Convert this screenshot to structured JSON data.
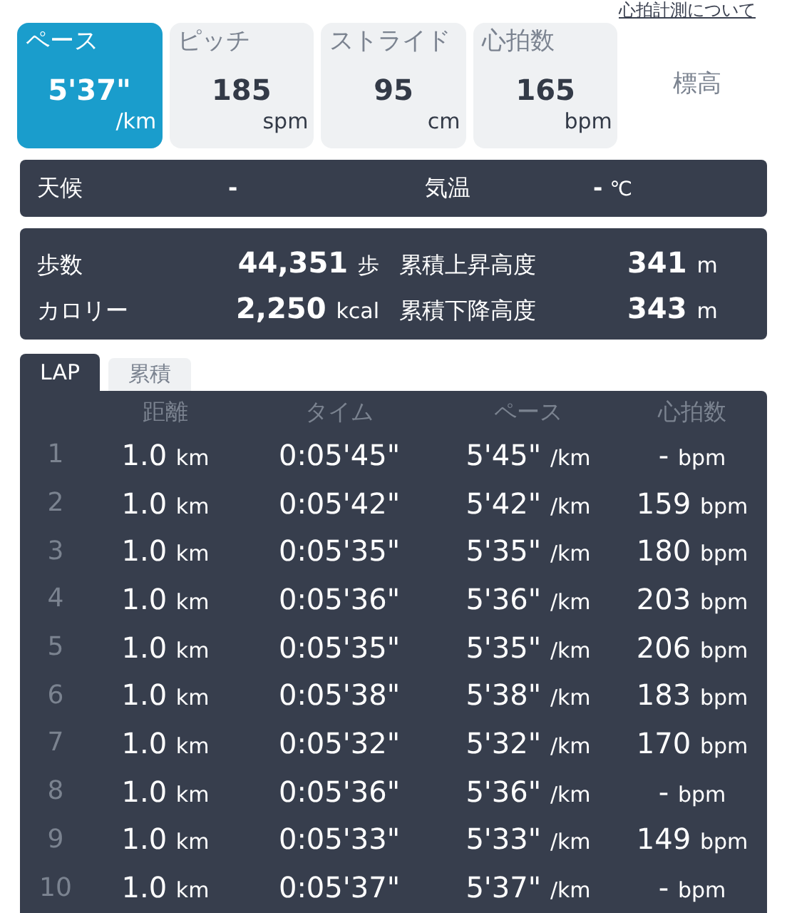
{
  "header_link": "心拍計測について",
  "metric_tiles": [
    {
      "label": "ペース",
      "value": "5'37\"",
      "unit": "/km",
      "selected": true
    },
    {
      "label": "ピッチ",
      "value": "185",
      "unit": "spm",
      "selected": false
    },
    {
      "label": "ストライド",
      "value": "95",
      "unit": "cm",
      "selected": false
    },
    {
      "label": "心拍数",
      "value": "165",
      "unit": "bpm",
      "selected": false
    },
    {
      "label": "標高",
      "selected": false
    }
  ],
  "weather": {
    "weather_label": "天候",
    "weather_value": "-",
    "temp_label": "気温",
    "temp_value": "-",
    "temp_unit": "℃"
  },
  "stats": [
    {
      "label": "歩数",
      "value": "44,351",
      "unit": "歩",
      "label2": "累積上昇高度",
      "value2": "341",
      "unit2": "m"
    },
    {
      "label": "カロリー",
      "value": "2,250",
      "unit": "kcal",
      "label2": "累積下降高度",
      "value2": "343",
      "unit2": "m"
    }
  ],
  "tabs": [
    {
      "label": "LAP",
      "selected": true
    },
    {
      "label": "累積",
      "selected": false
    }
  ],
  "table": {
    "columns": [
      "距離",
      "タイム",
      "ペース",
      "心拍数"
    ],
    "rows": [
      {
        "no": "1",
        "distance": "1.0",
        "distance_unit": "km",
        "time": "0:05'45\"",
        "pace": "5'45\"",
        "pace_unit": "/km",
        "hr": "-",
        "hr_unit": "bpm"
      },
      {
        "no": "2",
        "distance": "1.0",
        "distance_unit": "km",
        "time": "0:05'42\"",
        "pace": "5'42\"",
        "pace_unit": "/km",
        "hr": "159",
        "hr_unit": "bpm"
      },
      {
        "no": "3",
        "distance": "1.0",
        "distance_unit": "km",
        "time": "0:05'35\"",
        "pace": "5'35\"",
        "pace_unit": "/km",
        "hr": "180",
        "hr_unit": "bpm"
      },
      {
        "no": "4",
        "distance": "1.0",
        "distance_unit": "km",
        "time": "0:05'36\"",
        "pace": "5'36\"",
        "pace_unit": "/km",
        "hr": "203",
        "hr_unit": "bpm"
      },
      {
        "no": "5",
        "distance": "1.0",
        "distance_unit": "km",
        "time": "0:05'35\"",
        "pace": "5'35\"",
        "pace_unit": "/km",
        "hr": "206",
        "hr_unit": "bpm"
      },
      {
        "no": "6",
        "distance": "1.0",
        "distance_unit": "km",
        "time": "0:05'38\"",
        "pace": "5'38\"",
        "pace_unit": "/km",
        "hr": "183",
        "hr_unit": "bpm"
      },
      {
        "no": "7",
        "distance": "1.0",
        "distance_unit": "km",
        "time": "0:05'32\"",
        "pace": "5'32\"",
        "pace_unit": "/km",
        "hr": "170",
        "hr_unit": "bpm"
      },
      {
        "no": "8",
        "distance": "1.0",
        "distance_unit": "km",
        "time": "0:05'36\"",
        "pace": "5'36\"",
        "pace_unit": "/km",
        "hr": "-",
        "hr_unit": "bpm"
      },
      {
        "no": "9",
        "distance": "1.0",
        "distance_unit": "km",
        "time": "0:05'33\"",
        "pace": "5'33\"",
        "pace_unit": "/km",
        "hr": "149",
        "hr_unit": "bpm"
      },
      {
        "no": "10",
        "distance": "1.0",
        "distance_unit": "km",
        "time": "0:05'37\"",
        "pace": "5'37\"",
        "pace_unit": "/km",
        "hr": "-",
        "hr_unit": "bpm"
      }
    ]
  }
}
